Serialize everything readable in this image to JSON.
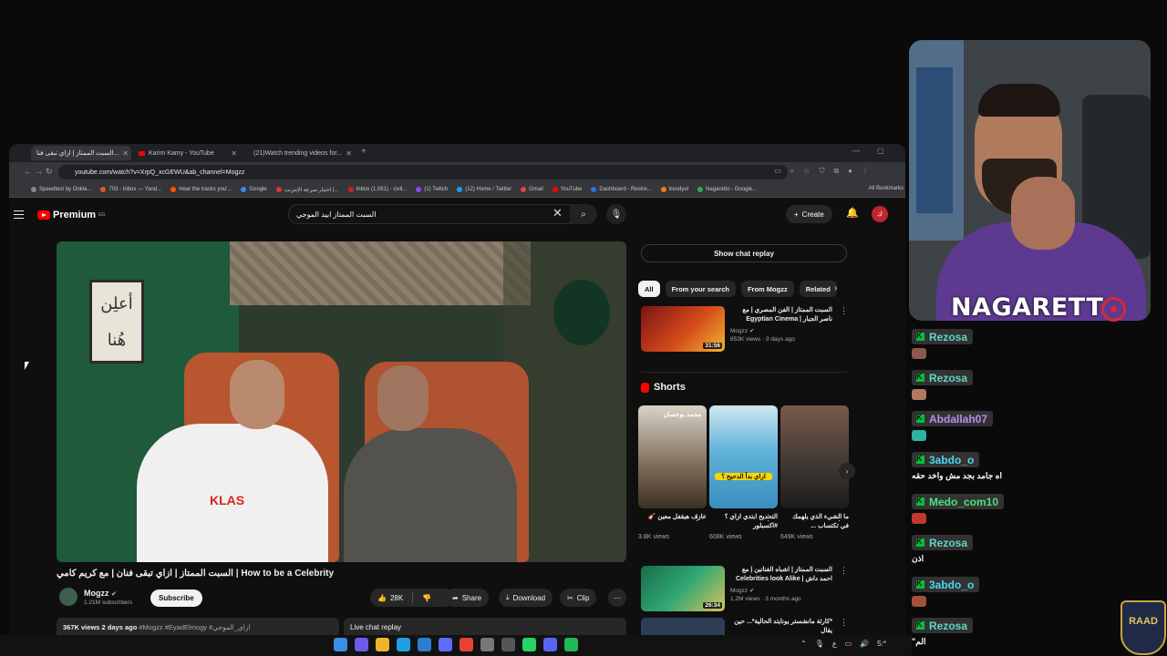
{
  "browser": {
    "tabs": [
      {
        "title": "السبت الممتاز | ازاي تبقى فنا..."
      },
      {
        "title": "Karim Kamy - YouTube"
      },
      {
        "title": "(21)Watch trending videos for..."
      }
    ],
    "url": "youtube.com/watch?v=XrpQ_xcGEWU&ab_channel=Mogzz",
    "bookmarks": [
      "Speedtest by Ookla...",
      "703 - Inbox — Yand...",
      "Hear the tracks you'...",
      "Google",
      "اختبار سرعة الإنترنت |...",
      "Inbox (1,061) - civil...",
      "(1) Twitch",
      "(12) Home / Twitter",
      "Gmail",
      "YouTube",
      "Dashboard - Restre...",
      "trendyol",
      "Nagaretto - Google..."
    ],
    "all_bookmarks": "All Bookmarks"
  },
  "youtube": {
    "logo_text": "Premium",
    "logo_region": "EG",
    "search_value": "السبت الممتاز ابيد الموجي",
    "create_label": "Create",
    "avatar_letter": "ك",
    "video_title": "السبت الممتاز | ازاي تبقى فنان | مع كريم كامي | How to be a Celebrity",
    "poster_text": "أعلِن هُنا",
    "shirt_text": "KLAS",
    "channel_name": "Mogzz",
    "subscribers": "1.21M subscribers",
    "subscribe_label": "Subscribe",
    "likes": "28K",
    "share_label": "Share",
    "download_label": "Download",
    "clip_label": "Clip",
    "views_date": "367K views  2 days ago",
    "hashtags": "#Mogzz #EyadElmogy #ازاي_الموجي",
    "live_chat_label": "Live chat replay",
    "show_chat_replay": "Show chat replay",
    "chips": [
      "All",
      "From your search",
      "From Mogzz",
      "Related"
    ],
    "recommendations": [
      {
        "title": "السبت الممتاز | الفن المصري | مع ناصر الجبار | Egyptian Cinema",
        "channel": "Mogzz",
        "meta": "853K views · 9 days ago",
        "duration": "31:56"
      },
      {
        "title": "السبت الممتاز | اشباه الفنانين | مع احمد داش | Celebrities look Alike with ...",
        "channel": "Mogzz",
        "meta": "1.2M views · 3 months ago",
        "duration": "26:34"
      },
      {
        "title": "*كارثة مانشستر يونايتد الحالية*... حين يقال",
        "channel": "",
        "meta": "",
        "duration": ""
      }
    ],
    "shorts_label": "Shorts",
    "shorts": [
      {
        "title": "عازف هيقفل معين 🎸",
        "views": "3.8K views",
        "overlay": "محمد بوحسان"
      },
      {
        "title": "التحديح ابتدي ازاي ؟ #اكسبلور",
        "views": "608K views",
        "overlay": "ازاي بدأ الدحيح ؟"
      },
      {
        "title": "ما الشيء الذي يلهمك في تكتساب ...",
        "views": "649K views",
        "overlay": ""
      }
    ]
  },
  "taskbar": {
    "tray_time": "5:*"
  },
  "stream": {
    "streamer_name": "NAGARETT",
    "brand_logo_text": "RAAD"
  },
  "chat": [
    {
      "user": "Rezosa",
      "color": "#60d4c4",
      "text": ""
    },
    {
      "user": "Rezosa",
      "color": "#60d4c4",
      "text": ""
    },
    {
      "user": "Abdallah07",
      "color": "#b48ef0",
      "text": ""
    },
    {
      "user": "3abdo_o",
      "color": "#4dd5f0",
      "text": "اه جامد بجد مش واخد حقه"
    },
    {
      "user": "Medo_com10",
      "color": "#4ee07a",
      "text": ""
    },
    {
      "user": "Rezosa",
      "color": "#60d4c4",
      "text": "اذن"
    },
    {
      "user": "3abdo_o",
      "color": "#4dd5f0",
      "text": ""
    },
    {
      "user": "Rezosa",
      "color": "#60d4c4",
      "text": "الم\""
    }
  ]
}
